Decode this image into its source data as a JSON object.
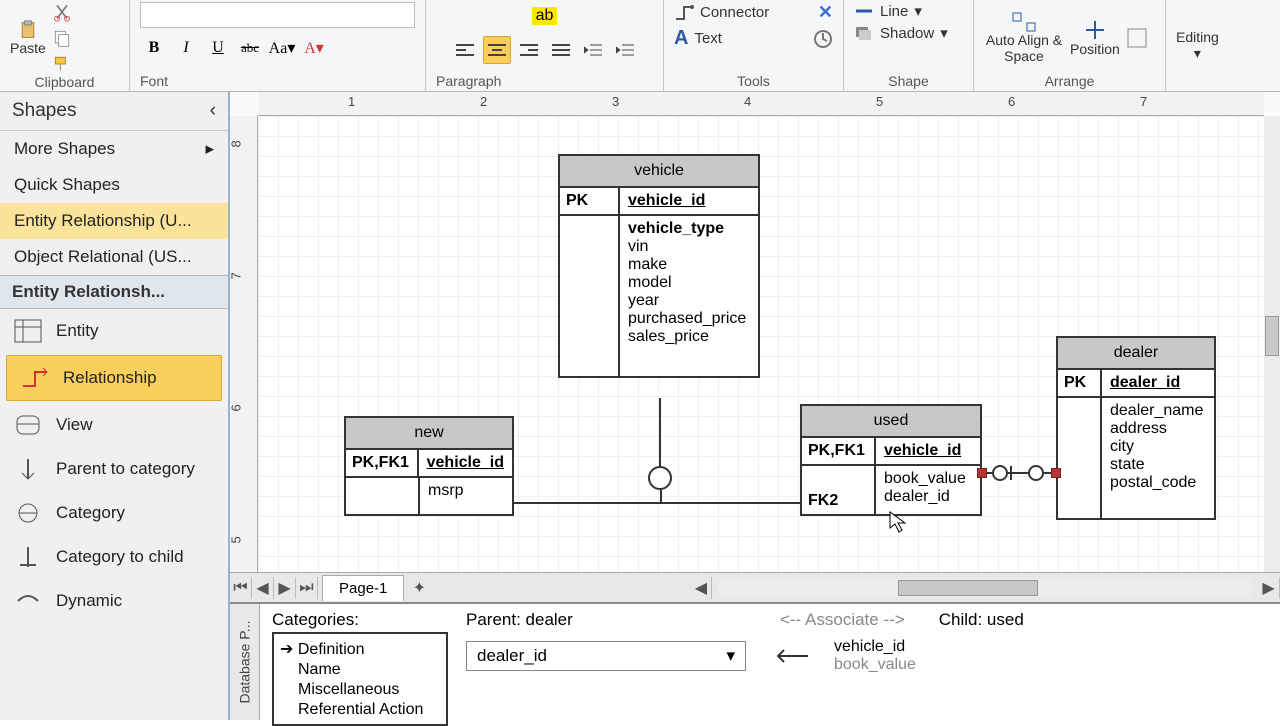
{
  "ribbon": {
    "clipboard": {
      "label": "Clipboard",
      "paste": "Paste"
    },
    "font": {
      "label": "Font",
      "bold": "B",
      "italic": "I",
      "underline": "U",
      "strike": "abc"
    },
    "paragraph": {
      "label": "Paragraph"
    },
    "tools": {
      "label": "Tools",
      "connector": "Connector",
      "text": "Text"
    },
    "shape": {
      "label": "Shape",
      "line": "Line",
      "shadow": "Shadow"
    },
    "arrange": {
      "label": "Arrange",
      "autoalign": "Auto Align & Space",
      "position": "Position"
    },
    "editing": {
      "label": "Editing"
    }
  },
  "left_panel": {
    "shapes": "Shapes",
    "more": "More Shapes",
    "quick": "Quick Shapes",
    "er": "Entity Relationship (U...",
    "or": "Object Relational (US...",
    "section": "Entity Relationsh...",
    "items": [
      {
        "label": "Entity"
      },
      {
        "label": "Relationship"
      },
      {
        "label": "View"
      },
      {
        "label": "Parent to category"
      },
      {
        "label": "Category"
      },
      {
        "label": "Category to child"
      },
      {
        "label": "Dynamic"
      }
    ]
  },
  "ruler": {
    "h": [
      "1",
      "2",
      "3",
      "4",
      "5",
      "6",
      "7"
    ],
    "v": [
      "8",
      "7",
      "6",
      "5"
    ]
  },
  "entities": {
    "vehicle": {
      "title": "vehicle",
      "pk_key": "PK",
      "pk": "vehicle_id",
      "attrs_bold": "vehicle_type",
      "attrs": [
        "vin",
        "make",
        "model",
        "year",
        "purchased_price",
        "sales_price"
      ]
    },
    "new": {
      "title": "new",
      "pk_key": "PK,FK1",
      "pk": "vehicle_id",
      "attrs": [
        "msrp"
      ]
    },
    "used": {
      "title": "used",
      "pk_key": "PK,FK1",
      "pk": "vehicle_id",
      "fk2": "FK2",
      "attrs": [
        "book_value",
        "dealer_id"
      ]
    },
    "dealer": {
      "title": "dealer",
      "pk_key": "PK",
      "pk": "dealer_id",
      "attrs": [
        "dealer_name",
        "address",
        "city",
        "state",
        "postal_code"
      ]
    }
  },
  "tabs": {
    "page1": "Page-1"
  },
  "db_panel": {
    "side": "Database P...",
    "categories_label": "Categories:",
    "cats": [
      "Definition",
      "Name",
      "Miscellaneous",
      "Referential Action"
    ],
    "parent_label": "Parent: dealer",
    "child_label": "Child: used",
    "parent_field": "dealer_id",
    "child_fields": [
      "vehicle_id",
      "book_value"
    ],
    "associate": "<-- Associate -->"
  }
}
